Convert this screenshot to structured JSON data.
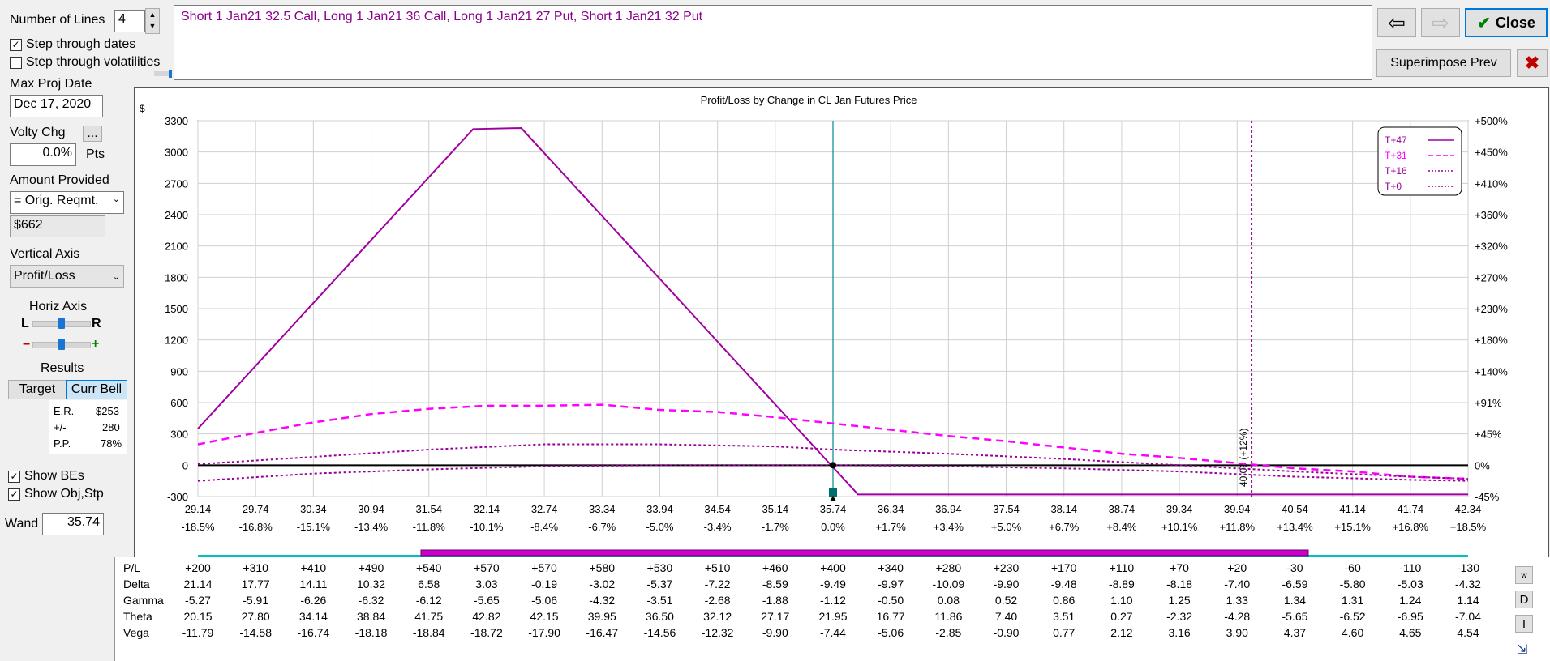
{
  "controls": {
    "number_of_lines_label": "Number of Lines",
    "number_of_lines_value": "4",
    "step_dates_label": "Step through dates",
    "step_dates_checked": true,
    "step_vols_label": "Step through volatilities",
    "step_vols_checked": false,
    "max_proj_date_label": "Max Proj Date",
    "max_proj_date_value": "Dec 17, 2020",
    "volty_chg_label": "Volty Chg",
    "volty_chg_value": "0.0%",
    "volty_chg_unit": "Pts",
    "volty_more_button": "...",
    "amount_provided_label": "Amount Provided",
    "amount_provided_value": "= Orig. Reqmt.",
    "amount_value": "$662",
    "vertical_axis_label": "Vertical Axis",
    "vertical_axis_value": "Profit/Loss",
    "horiz_axis_label": "Horiz Axis",
    "horiz_l": "L",
    "horiz_r": "R",
    "zoom_minus": "−",
    "zoom_plus": "+",
    "results_label": "Results",
    "target_tab": "Target",
    "curr_bell_tab": "Curr Bell",
    "er_label": "E.R.",
    "er_value": "$253",
    "pm_label": "+/-",
    "pm_value": "280",
    "pp_label": "P.P.",
    "pp_value": "78%",
    "show_bes_label": "Show BEs",
    "show_bes_checked": true,
    "show_obj_label": "Show Obj,Stp",
    "show_obj_checked": true,
    "wand_label": "Wand",
    "wand_value": "35.74"
  },
  "position_text": "Short 1 Jan21 32.5 Call, Long 1 Jan21 36 Call, Long 1 Jan21 27 Put, Short 1 Jan21 32 Put",
  "buttons": {
    "close": "Close",
    "superimpose": "Superimpose Prev"
  },
  "colors": {
    "t47": "#a000a0",
    "t31": "#ff00ff",
    "t16": "#9a009a",
    "t0": "#9a009a",
    "wand_line": "#008b8b",
    "target_line": "#9a009a",
    "accent_bar": "#cc00cc",
    "teal_bar": "#00c0c0",
    "bg": "#f0f0f0"
  },
  "chart_data": {
    "type": "line",
    "title": "Profit/Loss by Change in CL Jan Futures Price",
    "ylabel": "$",
    "ylim": [
      -300,
      3300
    ],
    "yticks": [
      3300,
      3000,
      2700,
      2400,
      2100,
      1800,
      1500,
      1200,
      900,
      600,
      300,
      0,
      -300
    ],
    "right_ticks": [
      "+500%",
      "+450%",
      "+410%",
      "+360%",
      "+320%",
      "+270%",
      "+230%",
      "+180%",
      "+140%",
      "+91%",
      "+45%",
      "0%",
      "-45%"
    ],
    "xlim": [
      29.14,
      42.34
    ],
    "x_ticks": [
      "29.14",
      "29.74",
      "30.34",
      "30.94",
      "31.54",
      "32.14",
      "32.74",
      "33.34",
      "33.94",
      "34.54",
      "35.14",
      "35.74",
      "36.34",
      "36.94",
      "37.54",
      "38.14",
      "38.74",
      "39.34",
      "39.94",
      "40.54",
      "41.14",
      "41.74",
      "42.34"
    ],
    "x_pct": [
      "-18.5%",
      "-16.8%",
      "-15.1%",
      "-13.4%",
      "-11.8%",
      "-10.1%",
      "-8.4%",
      "-6.7%",
      "-5.0%",
      "-3.4%",
      "-1.7%",
      "0.0%",
      "+1.7%",
      "+3.4%",
      "+5.0%",
      "+6.7%",
      "+8.4%",
      "+10.1%",
      "+11.8%",
      "+13.4%",
      "+15.1%",
      "+16.8%",
      "+18.5%"
    ],
    "series": [
      {
        "name": "T+47",
        "style": "solid",
        "x": [
          29.14,
          32.0,
          32.5,
          36.0,
          42.34
        ],
        "y": [
          350,
          3220,
          3230,
          -280,
          -280
        ]
      },
      {
        "name": "T+31",
        "style": "dash",
        "x": [
          29.14,
          29.74,
          30.34,
          30.94,
          31.54,
          32.14,
          32.74,
          33.34,
          33.94,
          34.54,
          35.14,
          35.74,
          36.34,
          36.94,
          37.54,
          38.14,
          38.74,
          39.34,
          39.94,
          40.54,
          41.14,
          41.74,
          42.34
        ],
        "y": [
          200,
          310,
          410,
          490,
          540,
          570,
          570,
          580,
          530,
          510,
          460,
          400,
          340,
          280,
          230,
          170,
          110,
          70,
          20,
          -30,
          -60,
          -110,
          -130
        ]
      },
      {
        "name": "T+16",
        "style": "dot",
        "x": [
          29.14,
          30.34,
          31.54,
          32.74,
          33.94,
          35.14,
          35.74,
          36.94,
          38.14,
          39.34,
          40.54,
          41.74,
          42.34
        ],
        "y": [
          10,
          80,
          150,
          200,
          200,
          180,
          150,
          110,
          60,
          0,
          -60,
          -110,
          -130
        ]
      },
      {
        "name": "T+0",
        "style": "dot",
        "x": [
          29.14,
          30.34,
          31.54,
          32.74,
          33.94,
          35.14,
          35.74,
          36.94,
          38.14,
          39.34,
          40.54,
          41.74,
          42.34
        ],
        "y": [
          -150,
          -80,
          -40,
          -10,
          0,
          0,
          0,
          -10,
          -30,
          -60,
          -110,
          -140,
          -150
        ]
      }
    ],
    "zero_line": 0,
    "wand_x": 35.74,
    "target_x": 40.09,
    "target_label": "40.09 (+12%)",
    "legend_position": "top-right",
    "grid": true
  },
  "greeks": {
    "row_labels": [
      "P/L",
      "Delta",
      "Gamma",
      "Theta",
      "Vega"
    ],
    "rows": [
      [
        "+200",
        "+310",
        "+410",
        "+490",
        "+540",
        "+570",
        "+570",
        "+580",
        "+530",
        "+510",
        "+460",
        "+400",
        "+340",
        "+280",
        "+230",
        "+170",
        "+110",
        "+70",
        "+20",
        "-30",
        "-60",
        "-110",
        "-130"
      ],
      [
        "21.14",
        "17.77",
        "14.11",
        "10.32",
        "6.58",
        "3.03",
        "-0.19",
        "-3.02",
        "-5.37",
        "-7.22",
        "-8.59",
        "-9.49",
        "-9.97",
        "-10.09",
        "-9.90",
        "-9.48",
        "-8.89",
        "-8.18",
        "-7.40",
        "-6.59",
        "-5.80",
        "-5.03",
        "-4.32"
      ],
      [
        "-5.27",
        "-5.91",
        "-6.26",
        "-6.32",
        "-6.12",
        "-5.65",
        "-5.06",
        "-4.32",
        "-3.51",
        "-2.68",
        "-1.88",
        "-1.12",
        "-0.50",
        "0.08",
        "0.52",
        "0.86",
        "1.10",
        "1.25",
        "1.33",
        "1.34",
        "1.31",
        "1.24",
        "1.14"
      ],
      [
        "20.15",
        "27.80",
        "34.14",
        "38.84",
        "41.75",
        "42.82",
        "42.15",
        "39.95",
        "36.50",
        "32.12",
        "27.17",
        "21.95",
        "16.77",
        "11.86",
        "7.40",
        "3.51",
        "0.27",
        "-2.32",
        "-4.28",
        "-5.65",
        "-6.52",
        "-6.95",
        "-7.04"
      ],
      [
        "-11.79",
        "-14.58",
        "-16.74",
        "-18.18",
        "-18.84",
        "-18.72",
        "-17.90",
        "-16.47",
        "-14.56",
        "-12.32",
        "-9.90",
        "-7.44",
        "-5.06",
        "-2.85",
        "-0.90",
        "0.77",
        "2.12",
        "3.16",
        "3.90",
        "4.37",
        "4.60",
        "4.65",
        "4.54"
      ]
    ],
    "side_buttons": [
      "w",
      "D",
      "I"
    ]
  }
}
